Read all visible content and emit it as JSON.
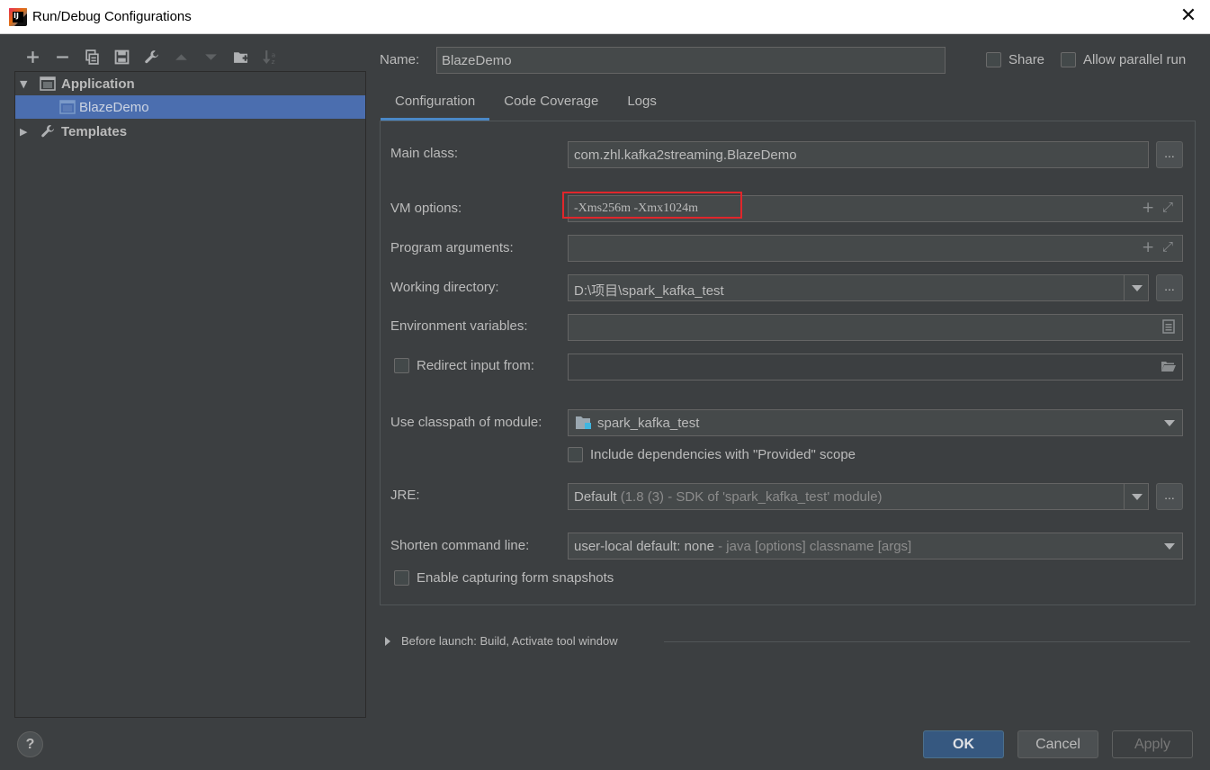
{
  "window": {
    "title": "Run/Debug Configurations"
  },
  "toolbar": {
    "icons": [
      "plus-icon",
      "minus-icon",
      "copy-icon",
      "save-icon",
      "wrench-icon",
      "arrow-up-icon",
      "arrow-down-icon",
      "new-folder-icon",
      "sort-icon"
    ]
  },
  "tree": {
    "application_label": "Application",
    "child_label": "BlazeDemo",
    "templates_label": "Templates"
  },
  "header": {
    "name_label": "Name:",
    "name_value": "BlazeDemo",
    "share_label": "Share",
    "parallel_label": "Allow parallel run"
  },
  "tabs": [
    {
      "label": "Configuration",
      "active": true
    },
    {
      "label": "Code Coverage",
      "active": false
    },
    {
      "label": "Logs",
      "active": false
    }
  ],
  "config": {
    "main_class_label": "Main class:",
    "main_class_value": "com.zhl.kafka2streaming.BlazeDemo",
    "vm_options_label": "VM options:",
    "vm_options_value": "-Xms256m -Xmx1024m",
    "program_args_label": "Program arguments:",
    "program_args_value": "",
    "working_dir_label": "Working directory:",
    "working_dir_value": "D:\\项目\\spark_kafka_test",
    "env_vars_label": "Environment variables:",
    "env_vars_value": "",
    "redirect_label": "Redirect input from:",
    "redirect_value": "",
    "classpath_label": "Use classpath of module:",
    "classpath_value": "spark_kafka_test",
    "include_deps_label": "Include dependencies with \"Provided\" scope",
    "jre_label": "JRE:",
    "jre_value_main": "Default",
    "jre_value_detail": " (1.8 (3) - SDK of 'spark_kafka_test' module)",
    "shorten_label": "Shorten command line:",
    "shorten_value_main": "user-local default: none",
    "shorten_value_detail": " - java [options] classname [args]",
    "snapshots_label": "Enable capturing form snapshots",
    "dots": "..."
  },
  "before_launch": {
    "label": "Before launch: Build, Activate tool window"
  },
  "buttons": {
    "help": "?",
    "ok": "OK",
    "cancel": "Cancel",
    "apply": "Apply"
  },
  "colors": {
    "background": "#3c3f41",
    "selection": "#4b6eaf",
    "ok_button": "#365880",
    "highlight_box": "#e0262b"
  }
}
